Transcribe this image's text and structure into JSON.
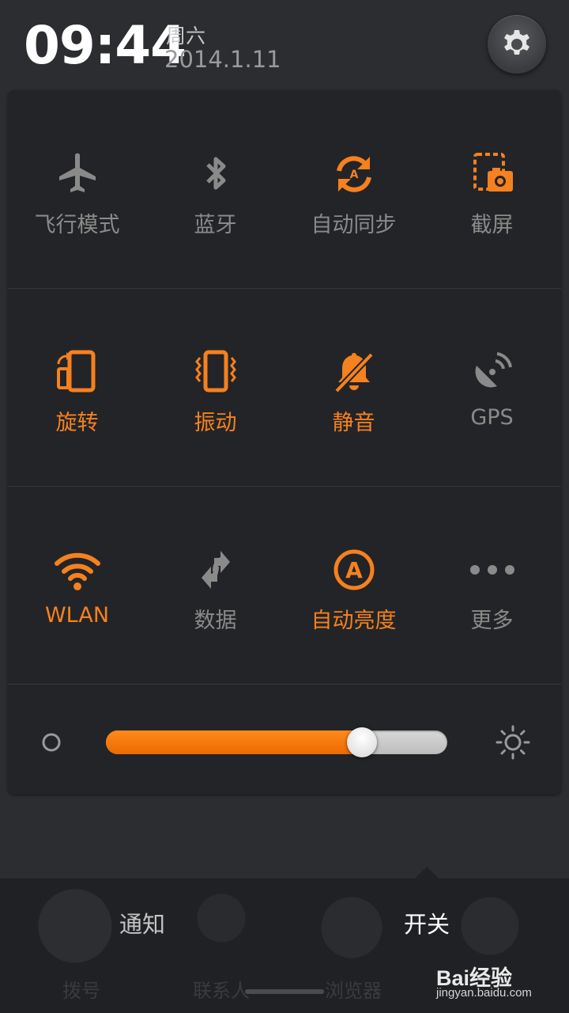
{
  "status": {
    "time": "09:44",
    "weekday": "周六",
    "date": "2014.1.11"
  },
  "toggles": [
    {
      "label": "飞行模式",
      "icon": "airplane-icon",
      "state": "off"
    },
    {
      "label": "蓝牙",
      "icon": "bluetooth-icon",
      "state": "off"
    },
    {
      "label": "自动同步",
      "icon": "sync-icon",
      "state": "on"
    },
    {
      "label": "截屏",
      "icon": "screenshot-icon",
      "state": "on"
    },
    {
      "label": "旋转",
      "icon": "rotate-icon",
      "state": "on"
    },
    {
      "label": "振动",
      "icon": "vibrate-icon",
      "state": "on"
    },
    {
      "label": "静音",
      "icon": "mute-icon",
      "state": "on"
    },
    {
      "label": "GPS",
      "icon": "gps-icon",
      "state": "off"
    },
    {
      "label": "WLAN",
      "icon": "wifi-icon",
      "state": "on"
    },
    {
      "label": "数据",
      "icon": "data-icon",
      "state": "off"
    },
    {
      "label": "自动亮度",
      "icon": "auto-brightness-icon",
      "state": "on"
    },
    {
      "label": "更多",
      "icon": "more-icon",
      "state": "off"
    }
  ],
  "brightness": {
    "level": 0.75
  },
  "tabs": {
    "notifications": "通知",
    "switches": "开关",
    "active": "switches"
  },
  "dock": {
    "labels": [
      "拨号",
      "联系人",
      "浏览器"
    ]
  },
  "watermark": {
    "logo": "Bai经验",
    "url": "jingyan.baidu.com"
  },
  "colors": {
    "accent": "#f5811f",
    "inactive": "#8a8a8a",
    "panel": "#232427"
  }
}
